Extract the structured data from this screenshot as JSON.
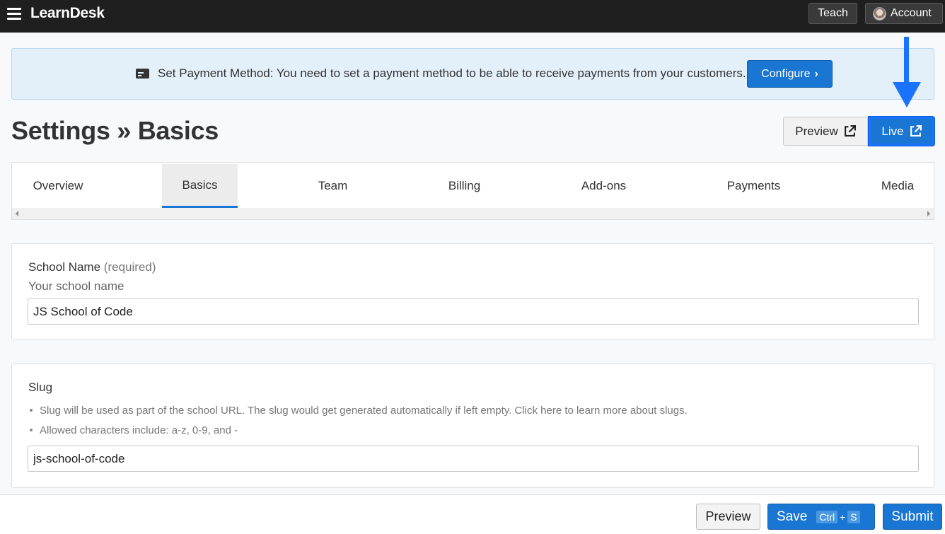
{
  "app": {
    "brand": "LearnDesk"
  },
  "topnav": {
    "teach_label": "Teach",
    "account_label": "Account"
  },
  "alert": {
    "message": "Set Payment Method: You need to set a payment method to be able to receive payments from your customers.",
    "configure_label": "Configure"
  },
  "header": {
    "title": "Settings » Basics",
    "preview_label": "Preview",
    "live_label": "Live"
  },
  "tabs": [
    {
      "label": "Overview"
    },
    {
      "label": "Basics"
    },
    {
      "label": "Team"
    },
    {
      "label": "Billing"
    },
    {
      "label": "Add-ons"
    },
    {
      "label": "Payments"
    },
    {
      "label": "Media"
    }
  ],
  "active_tab": "Basics",
  "school_name": {
    "label": "School Name",
    "required_note": "(required)",
    "help": "Your school name",
    "value": "JS School of Code"
  },
  "slug": {
    "label": "Slug",
    "bullets": [
      "Slug will be used as part of the school URL. The slug would get generated automatically if left empty. Click here to learn more about slugs.",
      "Allowed characters include: a-z, 0-9, and -"
    ],
    "value": "js-school-of-code"
  },
  "footer": {
    "preview_label": "Preview",
    "save_label": "Save",
    "shortcut_ctrl": "Ctrl",
    "shortcut_plus": "+",
    "shortcut_key": "S",
    "submit_label": "Submit"
  },
  "colors": {
    "primary": "#1976d2",
    "topbar": "#1f1f1f",
    "alert_bg": "#e3f0fa",
    "annotation_arrow": "#1a73ff"
  },
  "icons": {
    "menu": "hamburger-icon",
    "payment": "credit-card-icon",
    "external": "external-link-icon",
    "chevron": "chevron-right-icon"
  }
}
